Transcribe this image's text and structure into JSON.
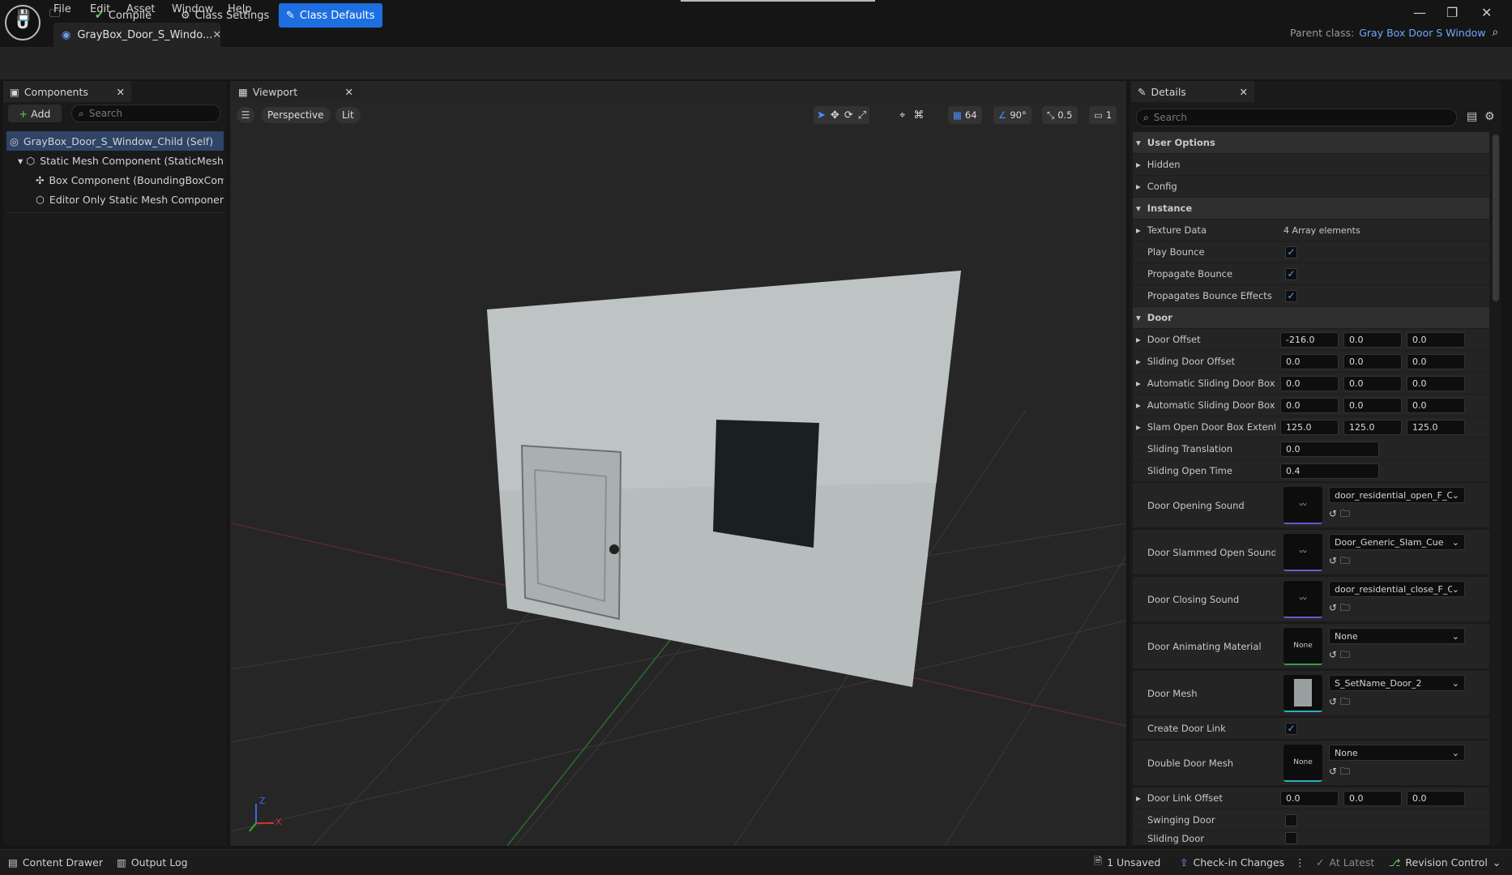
{
  "menu": [
    "File",
    "Edit",
    "Asset",
    "Window",
    "Help"
  ],
  "doc_tab": "GrayBox_Door_S_Windo...",
  "parent_class": {
    "label": "Parent class:",
    "value": "Gray Box Door S Window"
  },
  "toolbar": {
    "compile": "Compile",
    "class_settings": "Class Settings",
    "class_defaults": "Class Defaults"
  },
  "components": {
    "tab": "Components",
    "add": "Add",
    "search_placeholder": "Search",
    "tree": [
      "GrayBox_Door_S_Window_Child (Self)",
      "Static Mesh Component (StaticMeshC",
      "Box Component (BoundingBoxComp",
      "Editor Only Static Mesh Component ("
    ]
  },
  "viewport": {
    "tab": "Viewport",
    "perspective": "Perspective",
    "lit": "Lit",
    "grid": "64",
    "angle": "90°",
    "scale": "0.5",
    "camera": "1",
    "axis_z": "Z",
    "axis_x": "X"
  },
  "details": {
    "tab": "Details",
    "search_placeholder": "Search",
    "cat_user_options": "User Options",
    "hidden": "Hidden",
    "config": "Config",
    "cat_instance": "Instance",
    "texture_data": "Texture Data",
    "texture_data_value": "4 Array elements",
    "play_bounce": "Play Bounce",
    "propagate_bounce": "Propagate Bounce",
    "propagates_bounce_effects": "Propagates Bounce Effects",
    "cat_door": "Door",
    "door_offset": "Door Offset",
    "door_offset_v": [
      "-216.0",
      "0.0",
      "0.0"
    ],
    "sliding_door_offset": "Sliding Door Offset",
    "sliding_door_offset_v": [
      "0.0",
      "0.0",
      "0.0"
    ],
    "auto_box_e": "Automatic Sliding Door Box E...",
    "auto_box_e_v": [
      "0.0",
      "0.0",
      "0.0"
    ],
    "auto_box_o": "Automatic Sliding Door Box O...",
    "auto_box_o_v": [
      "0.0",
      "0.0",
      "0.0"
    ],
    "slam_box": "Slam Open Door Box Extent",
    "slam_box_v": [
      "125.0",
      "125.0",
      "125.0"
    ],
    "sliding_translation": "Sliding Translation",
    "sliding_translation_v": "0.0",
    "sliding_open_time": "Sliding Open Time",
    "sliding_open_time_v": "0.4",
    "door_opening_sound": "Door Opening Sound",
    "door_opening_sound_v": "door_residential_open_F_Cu",
    "door_slammed_sound": "Door Slammed Open Sound",
    "door_slammed_sound_v": "Door_Generic_Slam_Cue",
    "door_closing_sound": "Door Closing Sound",
    "door_closing_sound_v": "door_residential_close_F_C",
    "door_anim_material": "Door Animating Material",
    "door_anim_material_v": "None",
    "none_thumb": "None",
    "door_mesh": "Door Mesh",
    "door_mesh_v": "S_SetName_Door_2",
    "create_door_link": "Create Door Link",
    "double_door_mesh": "Double Door Mesh",
    "double_door_mesh_v": "None",
    "door_link_offset": "Door Link Offset",
    "door_link_offset_v": [
      "0.0",
      "0.0",
      "0.0"
    ],
    "swinging_door": "Swinging Door",
    "sliding_door": "Sliding Door"
  },
  "status": {
    "content_drawer": "Content Drawer",
    "output_log": "Output Log",
    "unsaved": "1 Unsaved",
    "checkin": "Check-in Changes",
    "at_latest": "At Latest",
    "revision": "Revision Control"
  }
}
